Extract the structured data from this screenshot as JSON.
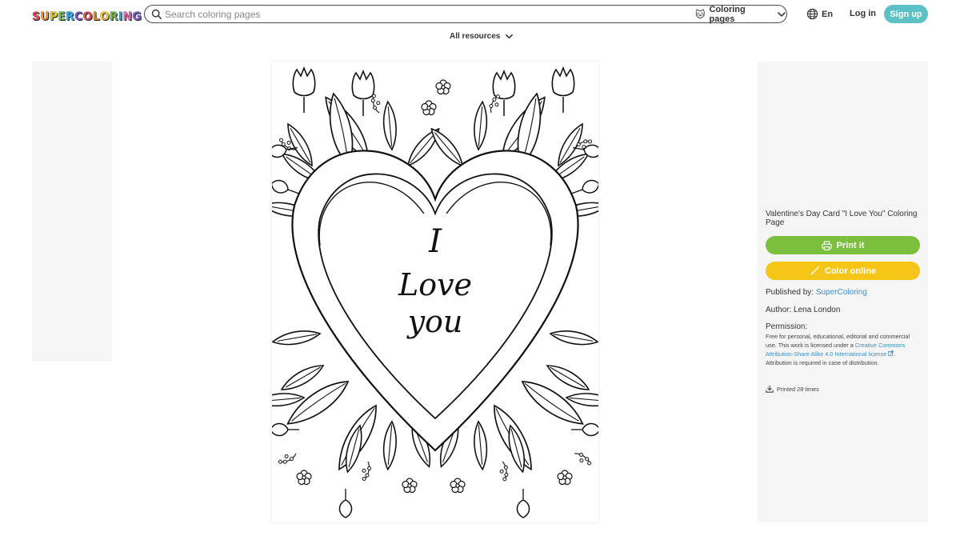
{
  "header": {
    "logo_letters": [
      {
        "ch": "S",
        "color": "#f04e4e"
      },
      {
        "ch": "U",
        "color": "#f7931e"
      },
      {
        "ch": "P",
        "color": "#ffd21f"
      },
      {
        "ch": "E",
        "color": "#7cc242"
      },
      {
        "ch": "R",
        "color": "#2bb5e8"
      },
      {
        "ch": "C",
        "color": "#8a5cc7"
      },
      {
        "ch": "O",
        "color": "#f04e4e"
      },
      {
        "ch": "L",
        "color": "#f7931e"
      },
      {
        "ch": "O",
        "color": "#ffd21f"
      },
      {
        "ch": "R",
        "color": "#7cc242"
      },
      {
        "ch": "I",
        "color": "#2bb5e8"
      },
      {
        "ch": "N",
        "color": "#f06ba8"
      },
      {
        "ch": "G",
        "color": "#8a5cc7"
      }
    ],
    "search_placeholder": "Search coloring pages",
    "category": "Coloring pages",
    "category_icon": "cat-face-icon",
    "language": "En",
    "login": "Log in",
    "signup": "Sign up"
  },
  "nav": {
    "all_resources": "All resources"
  },
  "artwork": {
    "line1": "I",
    "line2": "Love",
    "line3": "you"
  },
  "info": {
    "title": "Valentine's Day Card \"I Love You\" Coloring Page",
    "print_label": "Print it",
    "color_label": "Color online",
    "published_label": "Published by:",
    "publisher": "SuperColoring",
    "author": "Author: Lena London",
    "permission_label": "Permission:",
    "permission_text": "Free for personal, educational, editorial and commercial use. This work is licensed under a",
    "license_link": "Creative Commons Attribution-Share Alike 4.0 International license",
    "permission_suffix": ". Attribution is required in case of distribution.",
    "printed": "Printed 28 times"
  },
  "colors": {
    "signup_bg": "#5cc1c4",
    "print_bg": "#7cbf3f",
    "color_bg": "#f5c518",
    "link": "#3b8fc9"
  }
}
